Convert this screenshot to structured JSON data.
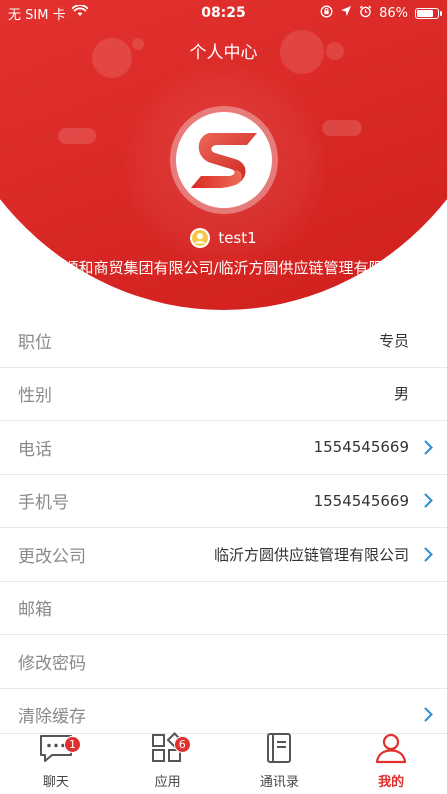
{
  "status_bar": {
    "carrier": "无 SIM 卡",
    "time": "08:25",
    "battery": "86%",
    "battery_level": 0.86
  },
  "header": {
    "title": "个人中心",
    "username": "test1",
    "company": "山东顺和商贸集团有限公司/临沂方圆供应链管理有限公司"
  },
  "profile_rows": [
    {
      "label": "职位",
      "value": "专员",
      "chevron": false
    },
    {
      "label": "性别",
      "value": "男",
      "chevron": false
    },
    {
      "label": "电话",
      "value": "1554545669",
      "chevron": true
    },
    {
      "label": "手机号",
      "value": "1554545669",
      "chevron": true
    },
    {
      "label": "更改公司",
      "value": "临沂方圆供应链管理有限公司",
      "chevron": true
    },
    {
      "label": "邮箱",
      "value": "",
      "chevron": false
    },
    {
      "label": "修改密码",
      "value": "",
      "chevron": false
    },
    {
      "label": "清除缓存",
      "value": "",
      "chevron": true
    }
  ],
  "tabs": [
    {
      "label": "聊天",
      "badge": "1",
      "icon": "chat-icon"
    },
    {
      "label": "应用",
      "badge": "6",
      "icon": "apps-icon"
    },
    {
      "label": "通讯录",
      "badge": "",
      "icon": "contacts-icon"
    },
    {
      "label": "我的",
      "badge": "",
      "icon": "profile-icon",
      "active": true
    }
  ],
  "colors": {
    "brand_red": "#e0302d",
    "chevron_blue": "#2b8fd6"
  }
}
